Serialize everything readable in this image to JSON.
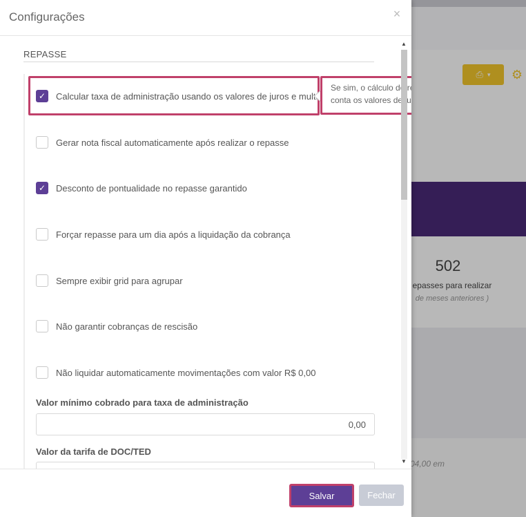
{
  "background": {
    "count_value": "502",
    "count_label": "epasses para realizar",
    "count_sublabel": "de meses anteriores )",
    "amount_text": "04,00 em"
  },
  "modal": {
    "title": "Configurações",
    "close_symbol": "×",
    "section_title": "REPASSE",
    "options": [
      {
        "label": "Calcular taxa de administração usando os valores de juros e multa.",
        "checked": true
      },
      {
        "label": "Gerar nota fiscal automaticamente após realizar o repasse",
        "checked": false
      },
      {
        "label": "Desconto de pontualidade no repasse garantido",
        "checked": true
      },
      {
        "label": "Forçar repasse para um dia após a liquidação da cobrança",
        "checked": false
      },
      {
        "label": "Sempre exibir grid para agrupar",
        "checked": false
      },
      {
        "label": "Não garantir cobranças de rescisão",
        "checked": false
      },
      {
        "label": "Não liquidar automaticamente movimentações com valor R$ 0,00",
        "checked": false
      }
    ],
    "tooltip": "Se sim, o cálculo do repasse é feito levando em conta os valores de juros e multa.",
    "fields": [
      {
        "label": "Valor mínimo cobrado para taxa de administração",
        "value": "0,00"
      },
      {
        "label": "Valor da tarifa de DOC/TED",
        "value": ""
      }
    ],
    "footer": {
      "save_label": "Salvar",
      "close_label": "Fechar"
    }
  },
  "colors": {
    "accent": "#5d3f96",
    "highlight": "#c0406a",
    "toolbar_yellow": "#f3c62b",
    "banner_purple": "#4a2a78"
  },
  "icons": {
    "checkmark": "check-icon",
    "print": "printer-icon",
    "settings": "gear-icon",
    "scroll_up": "caret-up-icon",
    "scroll_down": "caret-down-icon"
  }
}
